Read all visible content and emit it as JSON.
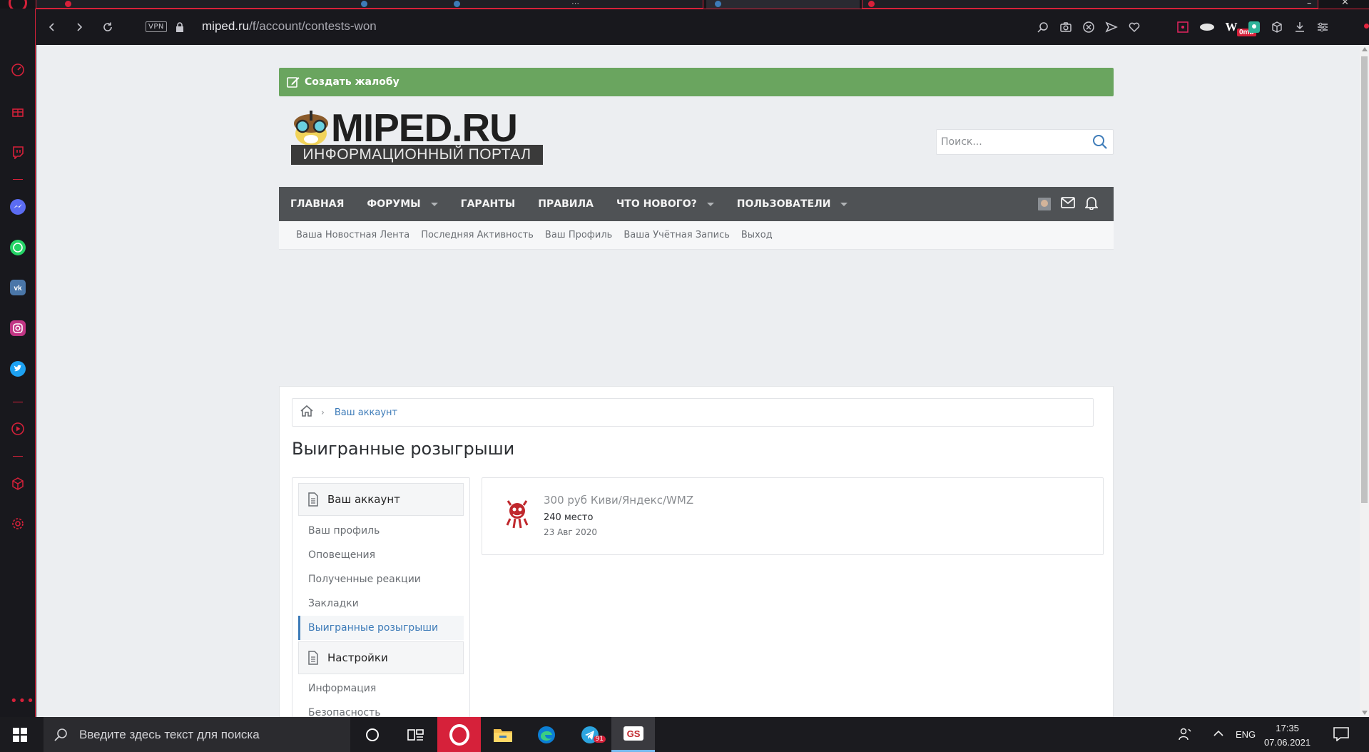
{
  "browser": {
    "address": {
      "domain": "miped.ru",
      "path": "/f/account/contests-won",
      "vpn_label": "VPN",
      "ad_block_badge": "0mb"
    }
  },
  "site": {
    "complaint_button": "Создать жалобу",
    "logo": {
      "title": "MIPED.RU",
      "subtitle": "ИНФОРМАЦИОННЫЙ ПОРТАЛ"
    },
    "search_placeholder": "Поиск...",
    "nav": [
      {
        "label": "Главная",
        "dropdown": false
      },
      {
        "label": "Форумы",
        "dropdown": true
      },
      {
        "label": "Гаранты",
        "dropdown": false
      },
      {
        "label": "Правила",
        "dropdown": false
      },
      {
        "label": "Что нового?",
        "dropdown": true
      },
      {
        "label": "Пользователи",
        "dropdown": true
      }
    ],
    "subnav": [
      "Ваша Новостная Лента",
      "Последняя Активность",
      "Ваш Профиль",
      "Ваша Учётная Запись",
      "Выход"
    ]
  },
  "page": {
    "breadcrumb": "Ваш аккаунт",
    "title": "Выигранные розыгрыши",
    "sidebar": {
      "account_header": "Ваш аккаунт",
      "account_links": [
        "Ваш профиль",
        "Оповещения",
        "Полученные реакции",
        "Закладки",
        "Выигранные розыгрыши"
      ],
      "active_link": "Выигранные розыгрыши",
      "settings_header": "Настройки",
      "settings_links": [
        "Информация",
        "Безопасность"
      ]
    },
    "contest": {
      "title": "300 руб Киви/Яндекс/WMZ",
      "place": "240 место",
      "date": "23 Авг 2020"
    }
  },
  "taskbar": {
    "search_placeholder": "Введите здесь текст для поиска",
    "language": "ENG",
    "time": "17:35",
    "date": "07.06.2021",
    "telegram_badge": "91"
  },
  "colors": {
    "opera_red": "#d6213a",
    "complaint_green": "#6aa55f",
    "nav_bg": "#4f5255",
    "link_blue": "#3d7bb8"
  }
}
